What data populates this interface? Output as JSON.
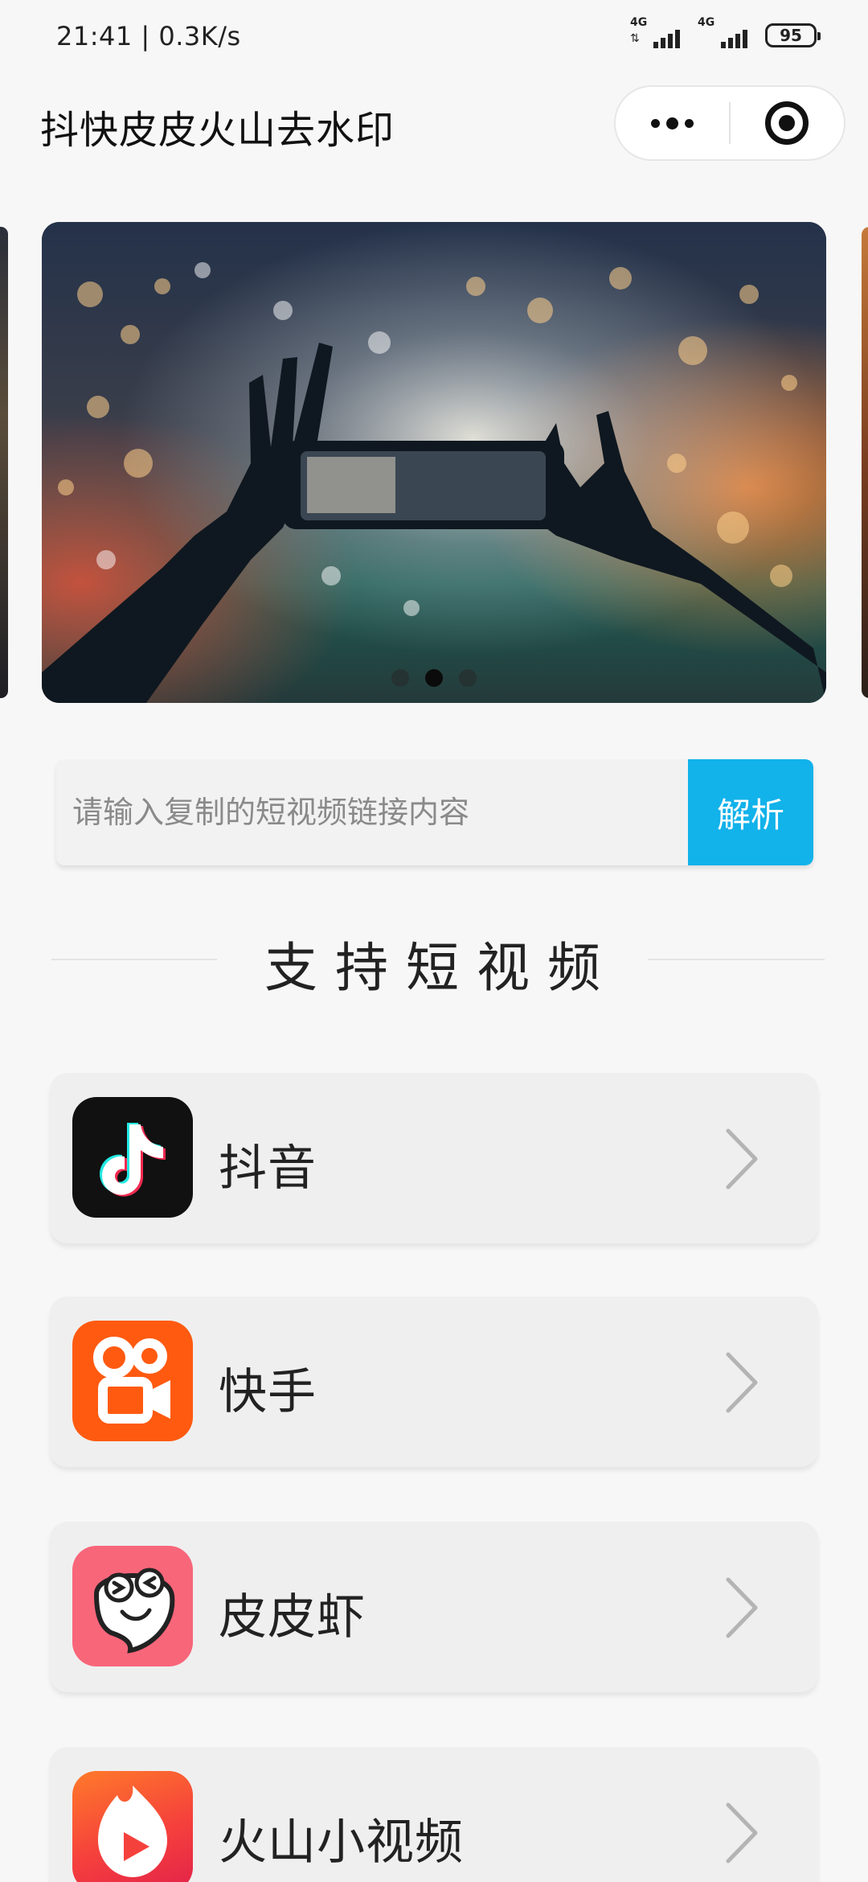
{
  "status_bar": {
    "time_speed": "21:41 | 0.3K/s",
    "network_1": "4G",
    "network_2": "4G",
    "battery": "95"
  },
  "nav": {
    "title": "抖快皮皮火山去水印",
    "more_icon": "more-dots-icon",
    "close_icon": "target-circle-icon"
  },
  "banner": {
    "page_count": 3,
    "active_index": 1
  },
  "search": {
    "placeholder": "请输入复制的短视频链接内容",
    "value": "",
    "button_label": "解析",
    "button_color": "#12b2ea"
  },
  "section": {
    "title": "支持短视频"
  },
  "platforms": [
    {
      "label": "抖音",
      "icon": "douyin-logo-icon",
      "color": "#111111"
    },
    {
      "label": "快手",
      "icon": "kuaishou-logo-icon",
      "color": "#ff5a10"
    },
    {
      "label": "皮皮虾",
      "icon": "pipixia-logo-icon",
      "color": "#f8667a"
    },
    {
      "label": "火山小视频",
      "icon": "huoshan-logo-icon",
      "color": "#f5413c"
    }
  ]
}
